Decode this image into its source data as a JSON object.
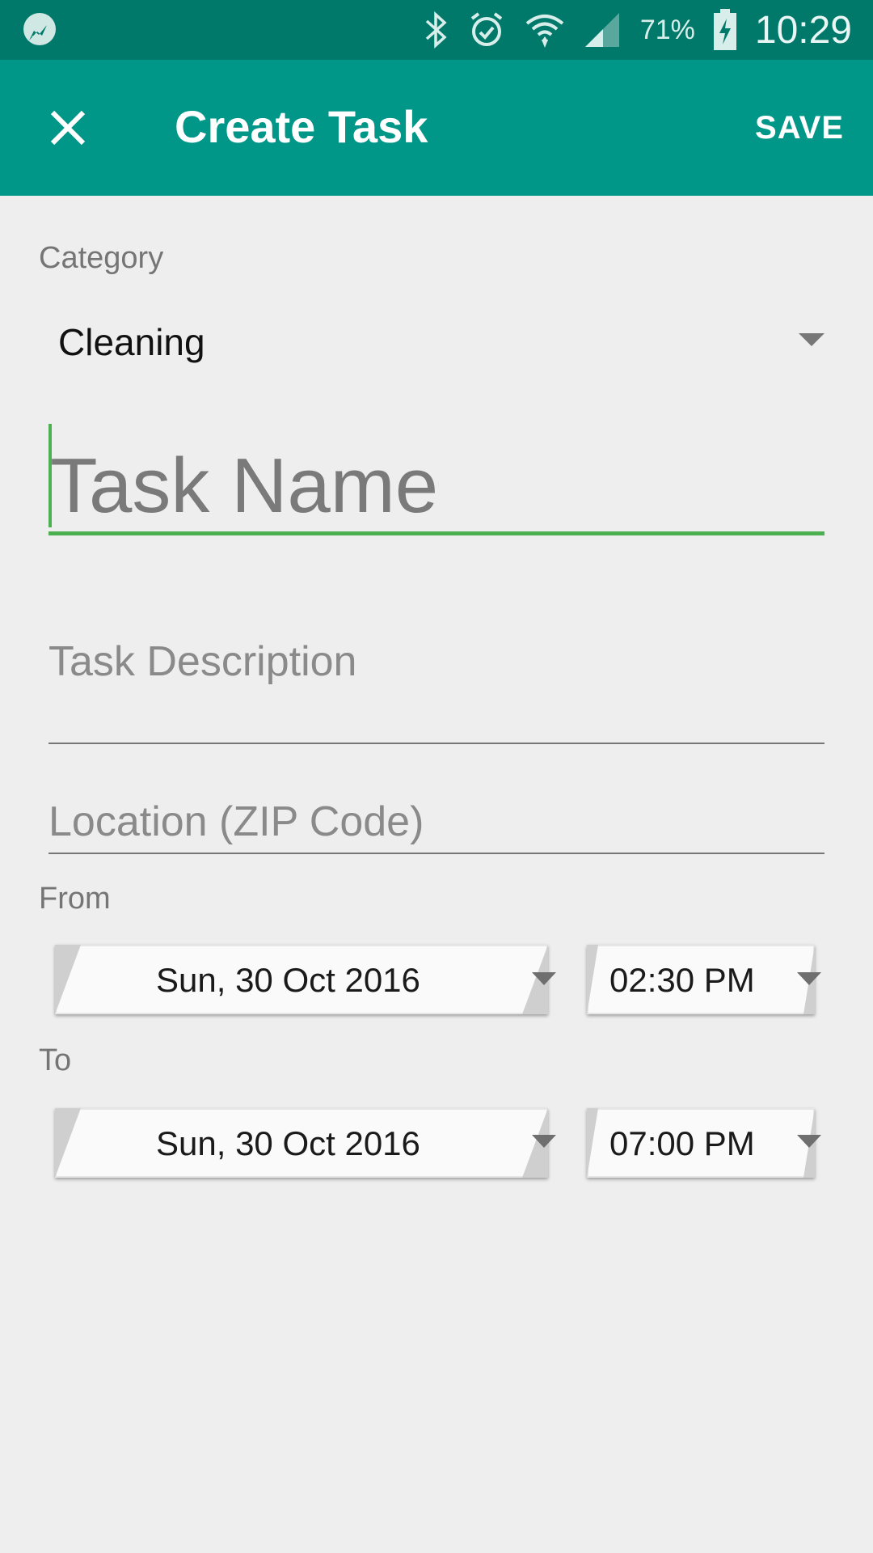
{
  "status_bar": {
    "battery": "71%",
    "time": "10:29",
    "icons": [
      "messenger-icon",
      "bluetooth-icon",
      "alarm-icon",
      "wifi-icon",
      "signal-icon",
      "battery-charging-icon"
    ]
  },
  "app_bar": {
    "title": "Create Task",
    "save_label": "SAVE",
    "close_icon": "close-icon"
  },
  "form": {
    "category_label": "Category",
    "category_value": "Cleaning",
    "task_name_placeholder": "Task Name",
    "task_description_placeholder": "Task Description",
    "location_placeholder": "Location (ZIP Code)",
    "from_label": "From",
    "from_date": "Sun, 30 Oct 2016",
    "from_time": "02:30 PM",
    "to_label": "To",
    "to_date": "Sun, 30 Oct 2016",
    "to_time": "07:00 PM"
  },
  "colors": {
    "status_bar": "#00796b",
    "app_bar": "#009688",
    "accent": "#4caf50",
    "background": "#eeeeee"
  }
}
